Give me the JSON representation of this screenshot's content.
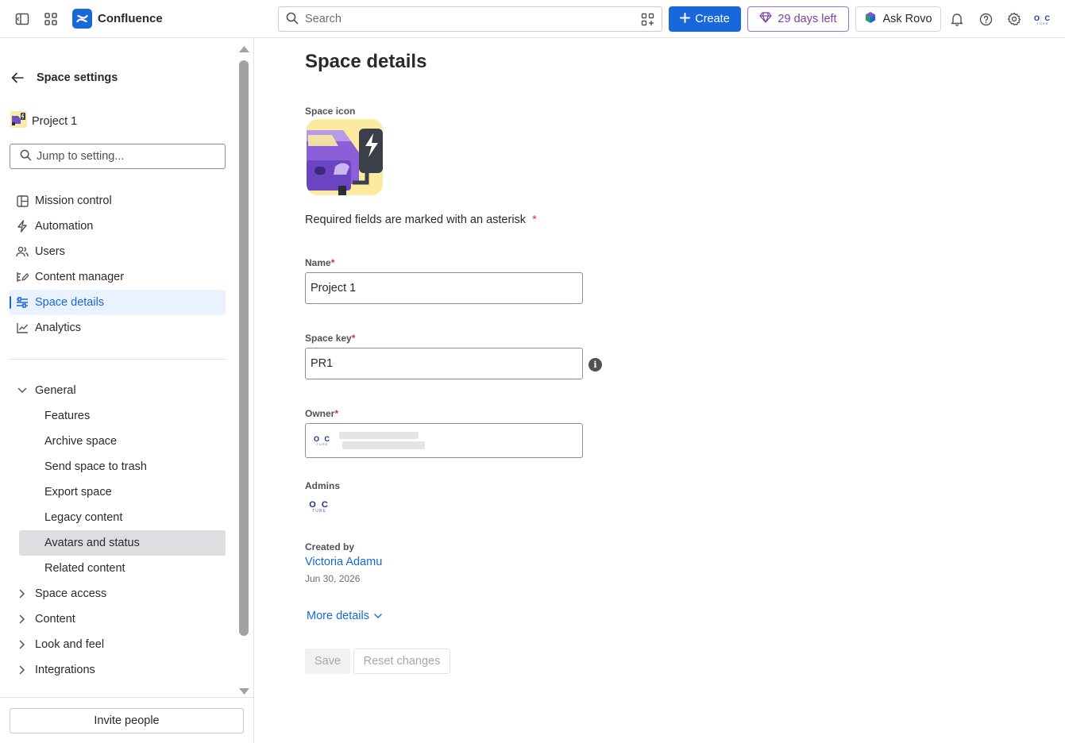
{
  "topbar": {
    "app_name": "Confluence",
    "search_placeholder": "Search",
    "create_label": "Create",
    "trial_label": "29 days left",
    "rovo_label": "Ask Rovo",
    "avatar_text": "O C",
    "avatar_subtext": "TURE"
  },
  "sidebar": {
    "title": "Space settings",
    "space_name": "Project 1",
    "search_placeholder": "Jump to setting...",
    "nav": [
      {
        "label": "Mission control",
        "icon": "layout-icon"
      },
      {
        "label": "Automation",
        "icon": "lightning-icon"
      },
      {
        "label": "Users",
        "icon": "people-icon"
      },
      {
        "label": "Content manager",
        "icon": "content-manager-icon"
      },
      {
        "label": "Space details",
        "icon": "sliders-icon",
        "active": true
      },
      {
        "label": "Analytics",
        "icon": "chart-icon"
      }
    ],
    "general": {
      "label": "General",
      "expanded": true,
      "items": [
        {
          "label": "Features"
        },
        {
          "label": "Archive space"
        },
        {
          "label": "Send space to trash"
        },
        {
          "label": "Export space"
        },
        {
          "label": "Legacy content"
        },
        {
          "label": "Avatars and status",
          "selected": true
        },
        {
          "label": "Related content"
        }
      ]
    },
    "collapsed_groups": [
      {
        "label": "Space access"
      },
      {
        "label": "Content"
      },
      {
        "label": "Look and feel"
      },
      {
        "label": "Integrations"
      }
    ],
    "invite_label": "Invite people"
  },
  "main": {
    "title": "Space details",
    "space_icon_label": "Space icon",
    "required_note": "Required fields are marked with an asterisk",
    "required_marker": "*",
    "name_label": "Name",
    "name_value": "Project 1",
    "space_key_label": "Space key",
    "space_key_value": "PR1",
    "owner_label": "Owner",
    "admins_label": "Admins",
    "created_by_label": "Created by",
    "created_by_name": "Victoria Adamu",
    "created_date": "Jun 30, 2026",
    "more_details_label": "More details",
    "save_label": "Save",
    "reset_label": "Reset changes"
  },
  "colors": {
    "brand_blue": "#1868db",
    "trial_purple": "#803fa5",
    "required_red": "#c9372c",
    "active_bg": "#e9f2fe",
    "selected_bg": "#dddee1"
  }
}
